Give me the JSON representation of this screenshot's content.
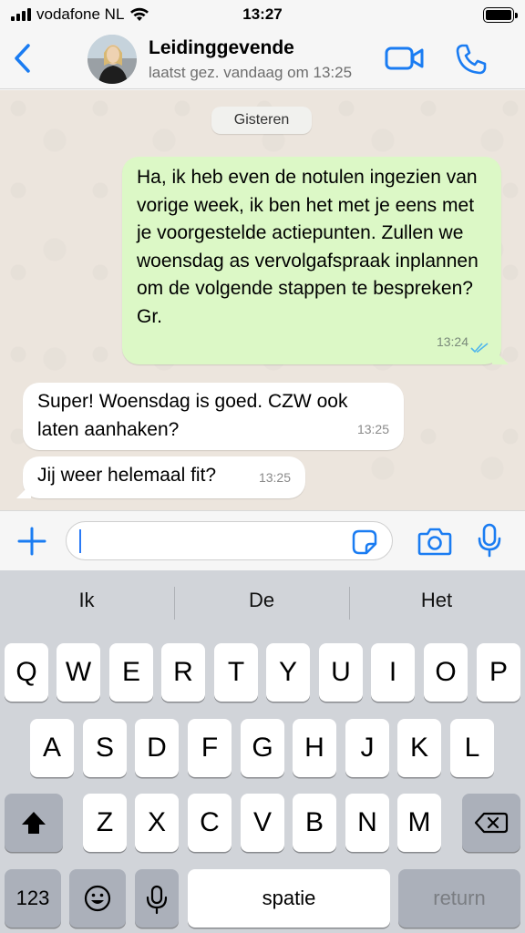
{
  "status_bar": {
    "carrier": "vodafone NL",
    "time": "13:27",
    "signal_icon": "signal-bars-icon",
    "wifi_icon": "wifi-icon",
    "battery_icon": "battery-icon"
  },
  "header": {
    "contact_name": "Leidinggevende",
    "contact_status": "laatst gez. vandaag om 13:25"
  },
  "chat": {
    "date_separator": "Gisteren",
    "messages": [
      {
        "direction": "outgoing",
        "text": "Ha, ik heb even de notulen ingezien van vorige week, ik ben het met je eens met je voorgestelde actiepunten. Zullen we woensdag as vervolgafspraak inplannen om de volgende stappen te bespreken? Gr.",
        "time": "13:24",
        "status": "read"
      },
      {
        "direction": "incoming",
        "text": "Super! Woensdag is goed. CZW ook laten aanhaken?",
        "time": "13:25"
      },
      {
        "direction": "incoming",
        "text": "Jij weer helemaal fit?",
        "time": "13:25"
      }
    ]
  },
  "input": {
    "value": ""
  },
  "keyboard": {
    "suggestions": [
      "Ik",
      "De",
      "Het"
    ],
    "rows": [
      [
        "Q",
        "W",
        "E",
        "R",
        "T",
        "Y",
        "U",
        "I",
        "O",
        "P"
      ],
      [
        "A",
        "S",
        "D",
        "F",
        "G",
        "H",
        "J",
        "K",
        "L"
      ],
      [
        "Z",
        "X",
        "C",
        "V",
        "B",
        "N",
        "M"
      ]
    ],
    "numbers_label": "123",
    "space_label": "spatie",
    "return_label": "return"
  },
  "colors": {
    "accent": "#1a7cf2",
    "outgoing_bubble": "#dcf8c6",
    "incoming_bubble": "#ffffff",
    "read_ticks": "#4fb6ec"
  }
}
